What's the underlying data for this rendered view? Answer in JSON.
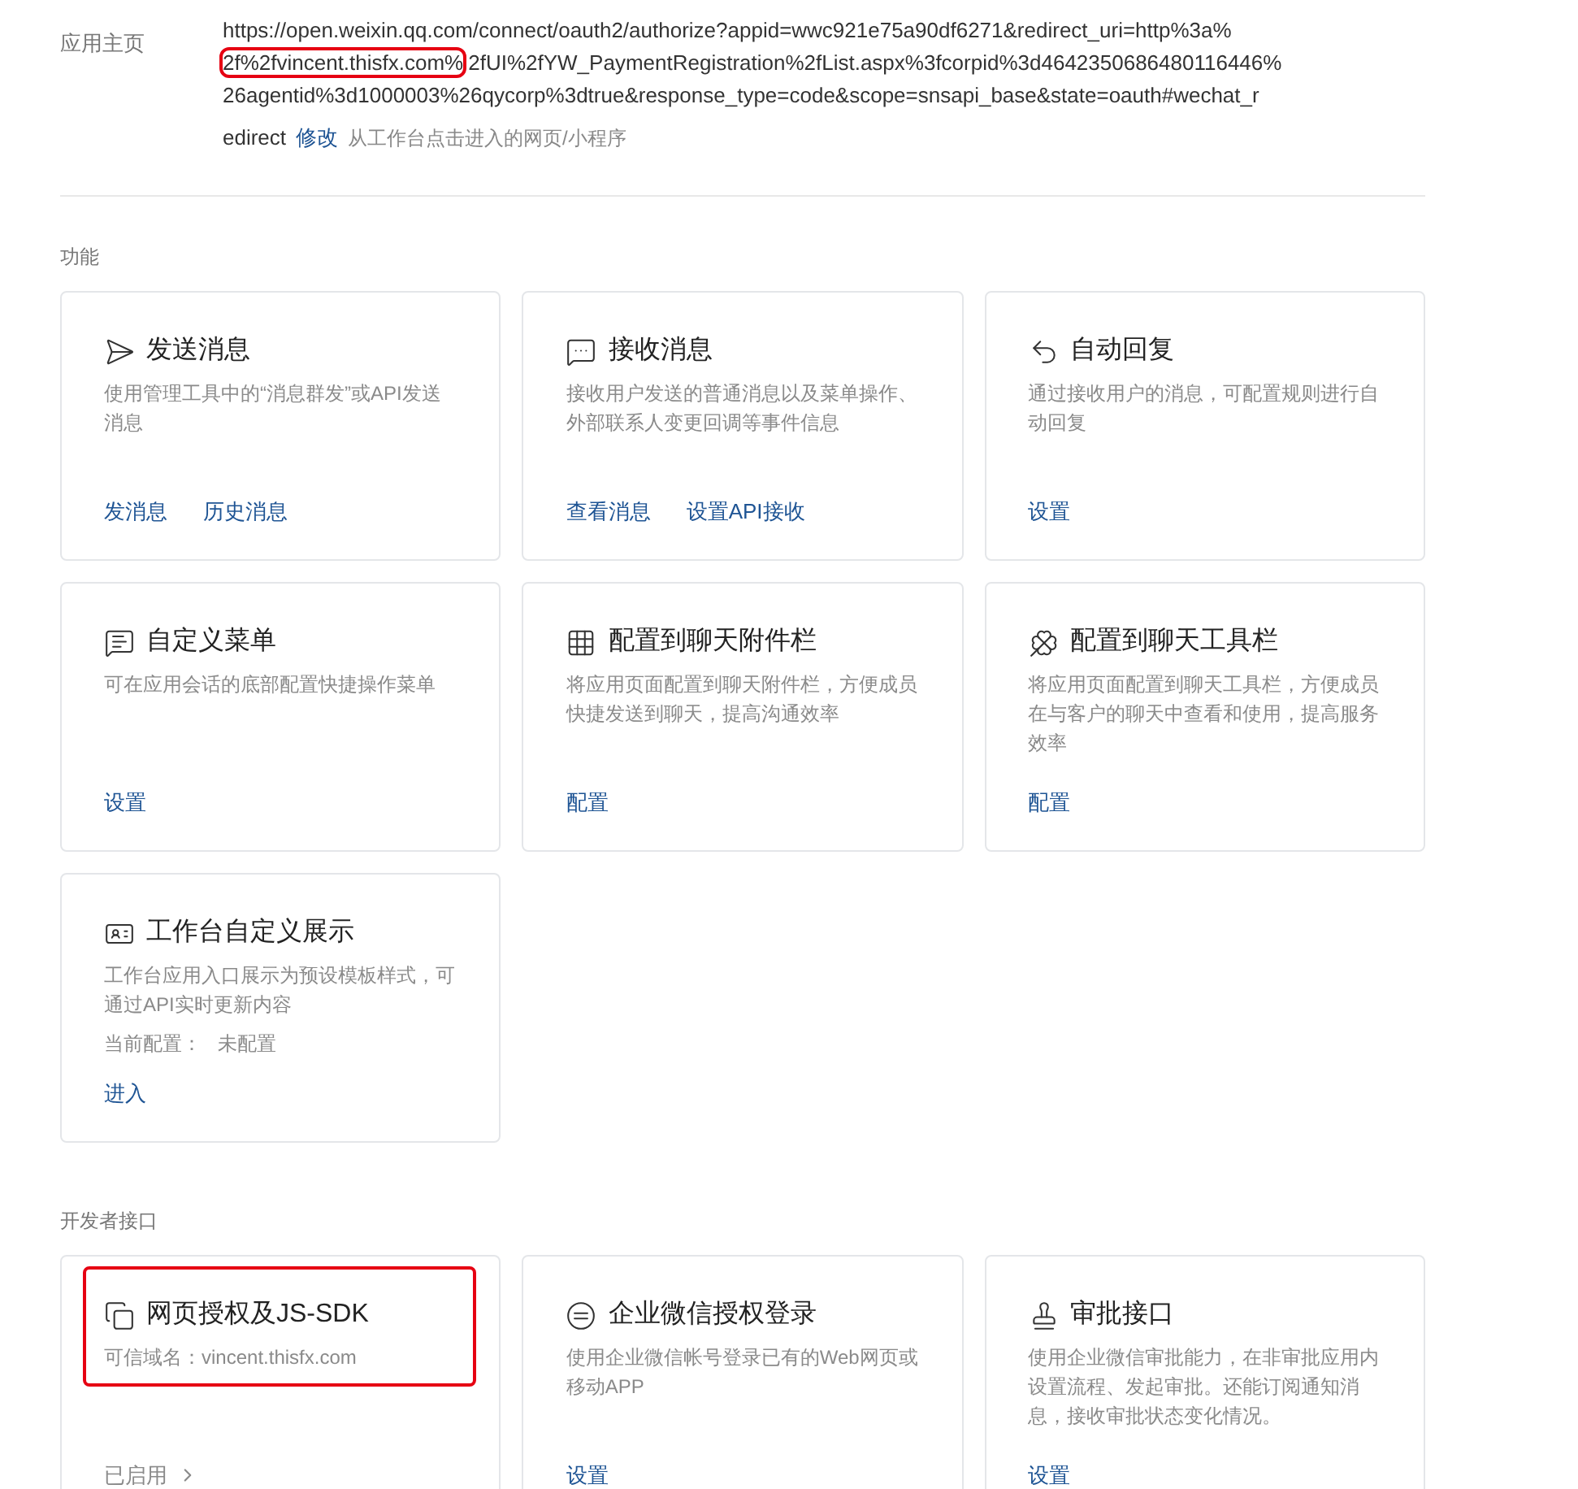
{
  "homepage": {
    "label": "应用主页",
    "url_lines": [
      [
        {
          "text": "https://open.weixin.qq.com/connect/oauth2/authorize?appid=wwc921e75a90df6271&redirect_uri=http%3a%",
          "highlighted": false
        }
      ],
      [
        {
          "text": "2f%2fvincent.thisfx.com%",
          "highlighted": true
        },
        {
          "text": "2fUI%2fYW_PaymentRegistration%2fList.aspx%3fcorpid%3d4642350686480116446%",
          "highlighted": false
        }
      ],
      [
        {
          "text": "26agentid%3d1000003%26qycorp%3dtrue&response_type=code&scope=snsapi_base&state=oauth#wechat_r",
          "highlighted": false
        }
      ],
      [
        {
          "text": "edirect",
          "highlighted": false
        }
      ]
    ],
    "edit_link": "修改",
    "hint": "从工作台点击进入的网页/小程序"
  },
  "sections": [
    {
      "title": "功能",
      "cards": [
        {
          "title": "发送消息",
          "description": "使用管理工具中的“消息群发”或API发送消息",
          "links": [
            "发消息",
            "历史消息"
          ],
          "highlighted": false
        },
        {
          "title": "接收消息",
          "description": "接收用户发送的普通消息以及菜单操作、外部联系人变更回调等事件信息",
          "links": [
            "查看消息",
            "设置API接收"
          ],
          "highlighted": false
        },
        {
          "title": "自动回复",
          "description": "通过接收用户的消息，可配置规则进行自动回复",
          "links": [
            "设置"
          ],
          "highlighted": false
        },
        {
          "title": "自定义菜单",
          "description": "可在应用会话的底部配置快捷操作菜单",
          "links": [
            "设置"
          ],
          "highlighted": false
        },
        {
          "title": "配置到聊天附件栏",
          "description": "将应用页面配置到聊天附件栏，方便成员快捷发送到聊天，提高沟通效率",
          "links": [
            "配置"
          ],
          "highlighted": false
        },
        {
          "title": "配置到聊天工具栏",
          "description": "将应用页面配置到聊天工具栏，方便成员在与客户的聊天中查看和使用，提高服务效率",
          "links": [
            "配置"
          ],
          "highlighted": false
        },
        {
          "title": "工作台自定义展示",
          "description": "工作台应用入口展示为预设模板样式，可通过API实时更新内容",
          "config_label": "当前配置：",
          "config_value": "未配置",
          "links": [
            "进入"
          ],
          "highlighted": false
        }
      ]
    },
    {
      "title": "开发者接口",
      "cards": [
        {
          "title": "网页授权及JS-SDK",
          "description": "可信域名：vincent.thisfx.com",
          "status": "已启用",
          "highlighted": true
        },
        {
          "title": "企业微信授权登录",
          "description": "使用企业微信帐号登录已有的Web网页或移动APP",
          "links": [
            "设置"
          ],
          "highlighted": false
        },
        {
          "title": "审批接口",
          "description": "使用企业微信审批能力，在非审批应用内设置流程、发起审批。还能订阅通知消息，接收审批状态变化情况。",
          "links": [
            "设置"
          ],
          "highlighted": false
        }
      ]
    }
  ]
}
